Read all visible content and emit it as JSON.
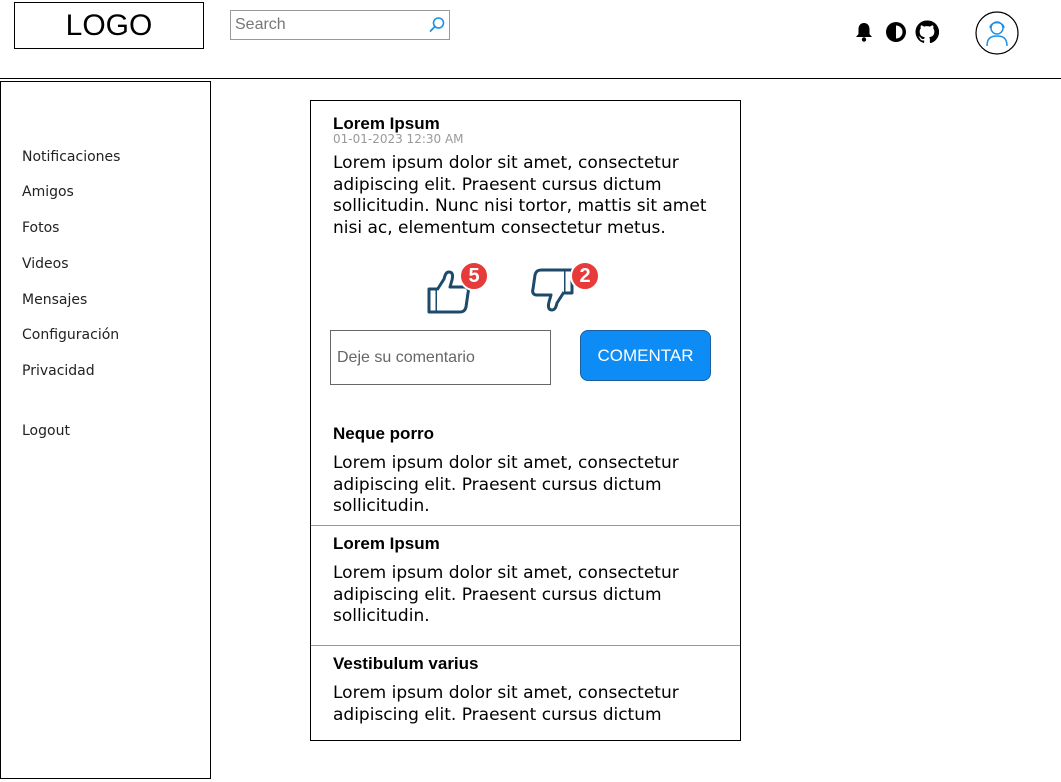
{
  "header": {
    "logo": "LOGO",
    "search_placeholder": "Search",
    "icons": [
      "bell-icon",
      "contrast-icon",
      "github-icon"
    ],
    "avatar_icon": "user-avatar-icon"
  },
  "sidebar": {
    "items": [
      {
        "label": "Notificaciones"
      },
      {
        "label": "Amigos"
      },
      {
        "label": "Fotos"
      },
      {
        "label": "Videos"
      },
      {
        "label": "Mensajes"
      },
      {
        "label": "Configuración"
      },
      {
        "label": "Privacidad"
      },
      {
        "label": "Logout"
      }
    ]
  },
  "feed": {
    "main_post": {
      "title": "Lorem Ipsum",
      "date": "01-01-2023 12:30 AM",
      "body": "Lorem ipsum dolor sit amet, consectetur adipiscing elit. Praesent cursus dictum sollicitudin. Nunc nisi tortor, mattis sit amet nisi ac, elementum consectetur metus.",
      "likes": "5",
      "dislikes": "2",
      "comment_placeholder": "Deje su comentario",
      "comment_button": "COMENTAR"
    },
    "posts": [
      {
        "title": "Neque porro",
        "body": "Lorem ipsum dolor sit amet, consectetur adipiscing elit. Praesent cursus dictum sollicitudin."
      },
      {
        "title": "Lorem Ipsum",
        "body": "Lorem ipsum dolor sit amet, consectetur adipiscing elit. Praesent cursus dictum sollicitudin."
      },
      {
        "title": "Vestibulum varius",
        "body": "Lorem ipsum dolor sit amet, consectetur adipiscing elit. Praesent cursus dictum"
      }
    ]
  },
  "colors": {
    "accent": "#0c8cf4",
    "badge": "#e73a3a",
    "thumb": "#1d4a6b"
  }
}
